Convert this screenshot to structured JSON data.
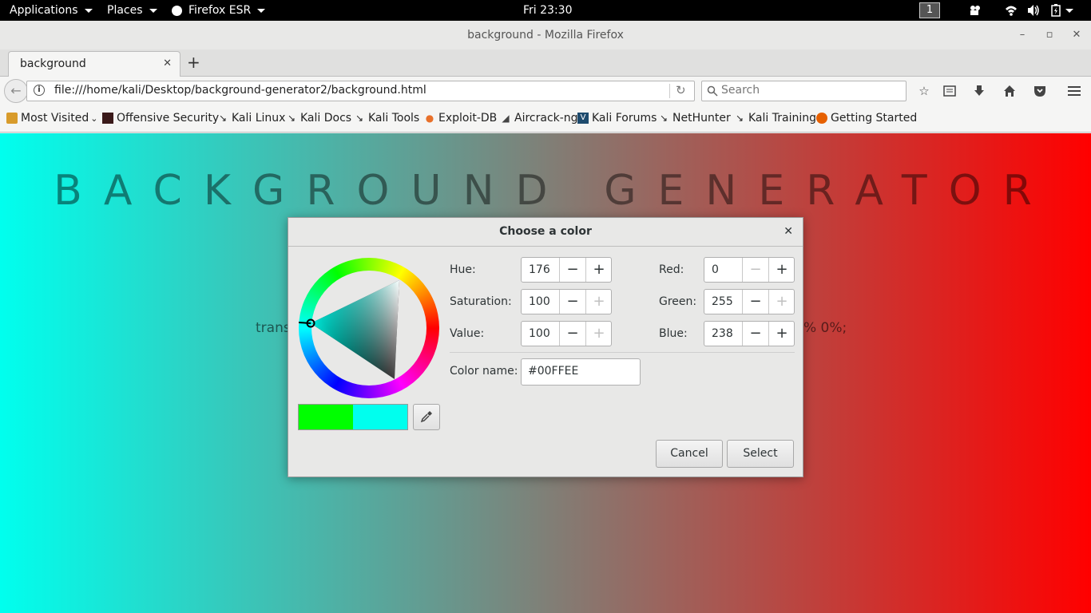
{
  "topbar": {
    "applications": "Applications",
    "places": "Places",
    "firefox": "Firefox ESR",
    "clock": "Fri 23:30",
    "workspace": "1"
  },
  "window": {
    "title": "background - Mozilla Firefox"
  },
  "tabs": [
    {
      "label": "background"
    }
  ],
  "navbar": {
    "url": "file:///home/kali/Desktop/background-generator2/background.html",
    "search_placeholder": "Search"
  },
  "bookmarks": [
    {
      "label": "Most Visited",
      "icon": "folder-icon"
    },
    {
      "label": "Offensive Security",
      "icon": "offsec-icon"
    },
    {
      "label": "Kali Linux",
      "icon": "kali-dragon-icon"
    },
    {
      "label": "Kali Docs",
      "icon": "kali-dragon-icon"
    },
    {
      "label": "Kali Tools",
      "icon": "kali-dragon-icon"
    },
    {
      "label": "Exploit-DB",
      "icon": "exploitdb-icon"
    },
    {
      "label": "Aircrack-ng",
      "icon": "aircrack-icon"
    },
    {
      "label": "Kali Forums",
      "icon": "kali-forums-icon"
    },
    {
      "label": "NetHunter",
      "icon": "kali-dragon-icon"
    },
    {
      "label": "Kali Training",
      "icon": "kali-dragon-icon"
    },
    {
      "label": "Getting Started",
      "icon": "firefox-icon"
    }
  ],
  "page": {
    "heading": "BACKGROUND GENERATOR",
    "css_text_left": "trans",
    "css_text_right": "% 0%;",
    "gradient_left": "#00ffee",
    "gradient_right": "#ff0000"
  },
  "dialog": {
    "title": "Choose a color",
    "hue_label": "Hue:",
    "hue": "176",
    "saturation_label": "Saturation:",
    "saturation": "100",
    "value_label": "Value:",
    "value": "100",
    "red_label": "Red:",
    "red": "0",
    "green_label": "Green:",
    "green": "255",
    "blue_label": "Blue:",
    "blue": "238",
    "color_name_label": "Color name:",
    "color_name": "#00FFEE",
    "previous_color": "#00ff00",
    "current_color": "#00ffee",
    "cancel": "Cancel",
    "select": "Select"
  }
}
